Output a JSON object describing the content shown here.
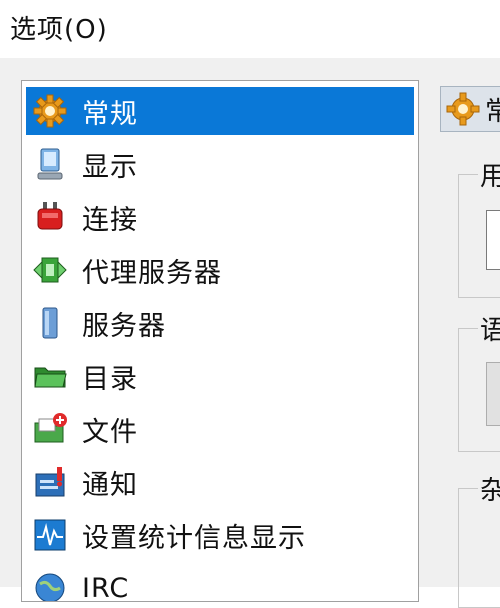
{
  "window": {
    "title": "选项(O)"
  },
  "nav": {
    "items": [
      {
        "label": "常规",
        "icon": "gear-icon",
        "selected": true
      },
      {
        "label": "显示",
        "icon": "monitor-icon",
        "selected": false
      },
      {
        "label": "连接",
        "icon": "plug-icon",
        "selected": false
      },
      {
        "label": "代理服务器",
        "icon": "proxy-icon",
        "selected": false
      },
      {
        "label": "服务器",
        "icon": "server-icon",
        "selected": false
      },
      {
        "label": "目录",
        "icon": "folder-icon",
        "selected": false
      },
      {
        "label": "文件",
        "icon": "file-icon",
        "selected": false
      },
      {
        "label": "通知",
        "icon": "notification-icon",
        "selected": false
      },
      {
        "label": "设置统计信息显示",
        "icon": "statistics-icon",
        "selected": false
      },
      {
        "label": "IRC",
        "icon": "irc-globe-icon",
        "selected": false
      }
    ]
  },
  "panel": {
    "header_title": "常",
    "group1_label": "用",
    "group2_label": "语",
    "group3_label": "杂"
  },
  "colors": {
    "selection": "#0a78d7",
    "annotation_arrow": "#e23ee8"
  }
}
